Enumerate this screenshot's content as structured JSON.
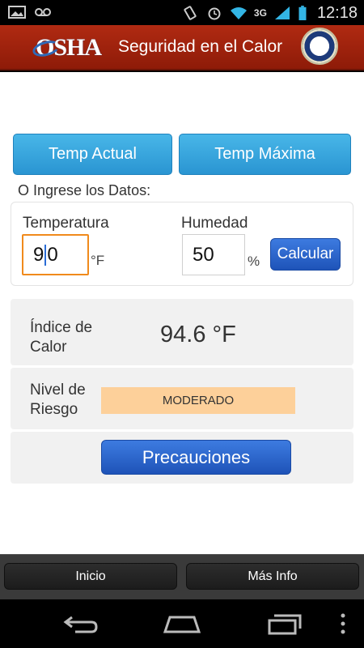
{
  "status_bar": {
    "time": "12:18",
    "network": "3G",
    "icons": [
      "image-icon",
      "voicemail-icon",
      "vibrate-icon",
      "alarm-icon",
      "wifi-icon",
      "signal-icon",
      "battery-icon"
    ]
  },
  "header": {
    "logo_text": "OSHA",
    "title": "Seguridad en el Calor",
    "seal": "dol-seal-icon"
  },
  "top_buttons": {
    "actual_label": "Temp Actual",
    "maxima_label": "Temp Máxima"
  },
  "form": {
    "subtitle": "O Ingrese los Datos:",
    "temperature_label": "Temperatura",
    "temperature_value_before_cursor": "9",
    "temperature_value_after_cursor": "0",
    "temperature_unit": "°F",
    "humidity_label": "Humedad",
    "humidity_value": "50",
    "humidity_unit": "%",
    "calculate_label": "Calcular"
  },
  "results": {
    "heat_index_label_line1": "Índice de",
    "heat_index_label_line2": "Calor",
    "heat_index_value": "94.6 °F",
    "risk_label_line1": "Nivel de",
    "risk_label_line2": "Riesgo",
    "risk_value": "MODERADO",
    "risk_color": "#fdd09a",
    "precautions_label": "Precauciones"
  },
  "tabbar": {
    "home_label": "Inicio",
    "info_label": "Más Info"
  },
  "nav_bar": {
    "icons": [
      "back-icon",
      "home-icon",
      "recents-icon",
      "overflow-menu-icon"
    ]
  },
  "colors": {
    "header_red": "#a02310",
    "button_blue": "#2a95d2",
    "action_blue": "#1e53b8",
    "focus_orange": "#f08a1c"
  }
}
